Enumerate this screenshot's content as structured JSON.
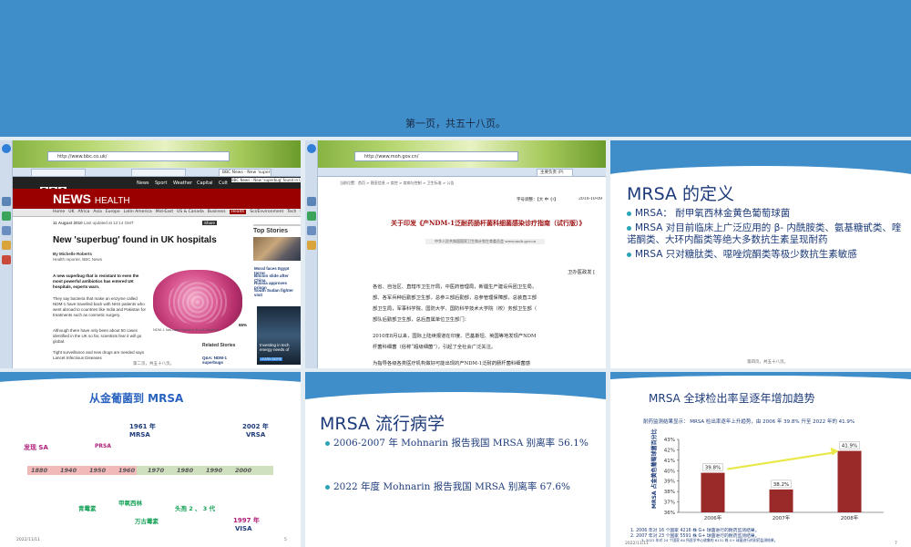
{
  "page": {
    "label": "第一页，共五十八页。"
  },
  "slide1": {
    "address": "http://www.bbc.co.uk/",
    "tabs": [
      "",
      "",
      "BBC News - New 'superb"
    ],
    "nav": [
      "News",
      "Sport",
      "Weather",
      "Capital",
      "Cult"
    ],
    "tab_extra": "BBC News - New 'superbug' found in UK hospitals",
    "brand_letters": [
      "B",
      "B",
      "C"
    ],
    "news_label": "NEWS",
    "health_label": "HEALTH",
    "subnav": [
      "Home",
      "UK",
      "Africa",
      "Asia",
      "Europe",
      "Latin America",
      "Mid-East",
      "US & Canada",
      "Business",
      "Health",
      "Sci/Environment",
      "Tech",
      "Entertainment"
    ],
    "date": "11 August 2010",
    "updated": "Last updated at 12:14 GMT",
    "headline": "New 'superbug' found in UK hospitals",
    "byline": "By Michelle Roberts",
    "byline_role": "Health reporter, BBC News",
    "lead": "A new superbug that is resistant to even the most powerful antibiotics has entered UK hospitals, experts warn.",
    "para1": "They say bacteria that make an enzyme called NDM-1 have travelled back with NHS patients who went abroad to countries like India and Pakistan for treatments such as cosmetic surgery.",
    "para2": "Although there have only been about 50 cases identified in the UK so far, scientists fear it will go global.",
    "para3": "Tight surveillance and new drugs are needed says Lancet Infectious Diseases",
    "caption": "NDM-1 has been found in E.coli bacteria",
    "share": "Share",
    "top_stories": "Top Stories",
    "stories": [
      "Moral faces Egypt terror",
      "Bitcoin slide after China",
      "Russia approves prison",
      "South Sudan fighter visit"
    ],
    "related": "Related Stories",
    "related_item": "Q&A: NDM-1 superbugs",
    "promo_text": "Investing in tech energy needs of",
    "promo_btn": "LEARN MORE",
    "footer": "第二页，共五十八页。",
    "percent": "65%"
  },
  "slide2": {
    "address": "http://www.moh.gov.cn/",
    "tab_label": "主要负责 (P)",
    "location": "当前位置：首页 > 稳妥信息 > 疾控 > 疾病与控制 > 卫生标准 > 公告",
    "font_controls": "字号调整：【大 中 小】",
    "date": "2010-10-09",
    "title": "关于印发《产NDM-1泛耐药肠杆菌科细菌感染诊疗指南（试行版）》",
    "source": "中华人民共和国国家卫生和计划生育委员会    www.moh.gov.cn",
    "office": "卫办医政发 [",
    "lines": [
      "各省、自治区、直辖市卫生厅局，中医药管理局，新疆生产建设兵团卫生局，",
      "部、各军兵种后勤部卫生部，总参三部后勤部，总参管理保障部，总装直工部",
      "部卫生局，军事科学院、国防大学、国防科学技术大学院（校）务部卫生部（",
      "部队后勤部卫生部，总后直属单位卫生部门："
    ],
    "para2": [
      "    2010年8月以来，国际上陆续报道在印度、巴基斯坦、英国等地发现产NDM",
      "杆菌科细菌（俗称“超级细菌”），引起了全社会广泛关注。"
    ],
    "para3": "    为指导各级各类医疗机构做好可能出现的产NDM-1泛耐药肠杆菌科细菌感"
  },
  "slide3": {
    "title": "MRSA 的定义",
    "bullets": [
      "MRSA： 耐甲氧西林金黄色葡萄球菌",
      "MRSA 对目前临床上广泛应用的 β- 内酰胺类、氨基糖甙类、喹诺酮类、大环内酯类等绝大多数抗生素呈现耐药",
      "MRSA 只对糖肽类、噁唑烷酮类等极少数抗生素敏感"
    ],
    "footer": "第四页，共五十八页。"
  },
  "slide4": {
    "title": "从金葡菌到 MRSA",
    "years": [
      "1880",
      "1940",
      "1950",
      "1960",
      "1970",
      "1980",
      "1990",
      "2000"
    ],
    "above": [
      {
        "text": "发现 SA",
        "color": "#b0207a"
      },
      {
        "text": "PRSA",
        "color": "#b0207a"
      },
      {
        "text": "1961 年",
        "color": "#1d3b7a"
      },
      {
        "text": "MRSA",
        "color": "#1d3b7a"
      },
      {
        "text": "2002 年",
        "color": "#1d3b7a"
      },
      {
        "text": "VRSA",
        "color": "#1d3b7a"
      }
    ],
    "below": [
      {
        "text": "青霉素",
        "color": "#1aa35a"
      },
      {
        "text": "甲氧西林",
        "color": "#1aa35a"
      },
      {
        "text": "万古霉素",
        "color": "#1aa35a"
      },
      {
        "text": "头孢 2 、 3 代",
        "color": "#1aa35a"
      },
      {
        "text": "1997 年",
        "color": "#b0207a"
      },
      {
        "text": "VISA",
        "color": "#1d3b7a"
      }
    ],
    "date": "2022/11/11",
    "page": "5"
  },
  "slide5": {
    "title": "MRSA 流行病学",
    "bullets": [
      "2006-2007 年 Mohnarin 报告我国 MRSA 别离率 56.1%",
      "2022 年度 Mohnarin 报告我国 MRSA 别离率 67.6%"
    ]
  },
  "slide6": {
    "title": "MRSA 全球检出率呈逐年增加趋势",
    "subtitle": "耐药监测结果显示： MRSA 检出率逐年上升趋势，由 2006 年 39.8% 升至 2022 年的  41.9%",
    "date": "2022/11/11",
    "page": "7",
    "notes": [
      "1.    2006 年对 16 个国家 4216 株 G+ 球菌进行的耐药监测结果。",
      "2.    2007 年对 23 个国家 5591 株 G+ 球菌进行的耐药监测结果。",
      "3.    2022 年对 24 个国家 64 所医学中心收集的 6131 株 G+ 球菌进行的耐药监测结果。"
    ],
    "chart_data": {
      "type": "bar",
      "categories": [
        "2006年",
        "2007年",
        "2008年"
      ],
      "values": [
        39.8,
        38.2,
        41.9
      ],
      "value_labels": [
        "39.8%",
        "38.2%",
        "41.9%"
      ],
      "ylabel": "MRSA 占金黄色葡萄球菌百分比",
      "yticks": [
        "36%",
        "37%",
        "38%",
        "39%",
        "40%",
        "41%",
        "42%",
        "43%"
      ],
      "ylim": [
        36,
        43
      ],
      "bar_color": "#9a2a2a",
      "grid": false
    }
  }
}
